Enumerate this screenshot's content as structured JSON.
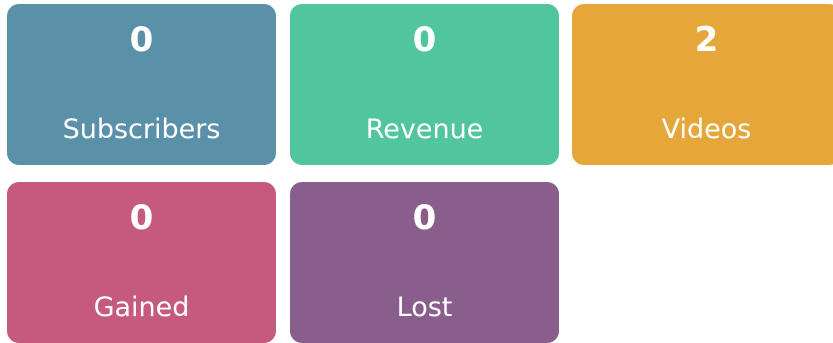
{
  "stats": [
    {
      "key": "subscribers",
      "value": "0",
      "label": "Subscribers",
      "color": "#5B91A8"
    },
    {
      "key": "revenue",
      "value": "0",
      "label": "Revenue",
      "color": "#50C59E"
    },
    {
      "key": "videos",
      "value": "2",
      "label": "Videos",
      "color": "#E6A73A"
    },
    {
      "key": "gained",
      "value": "0",
      "label": "Gained",
      "color": "#C55A7E"
    },
    {
      "key": "lost",
      "value": "0",
      "label": "Lost",
      "color": "#8A5E8C"
    }
  ]
}
